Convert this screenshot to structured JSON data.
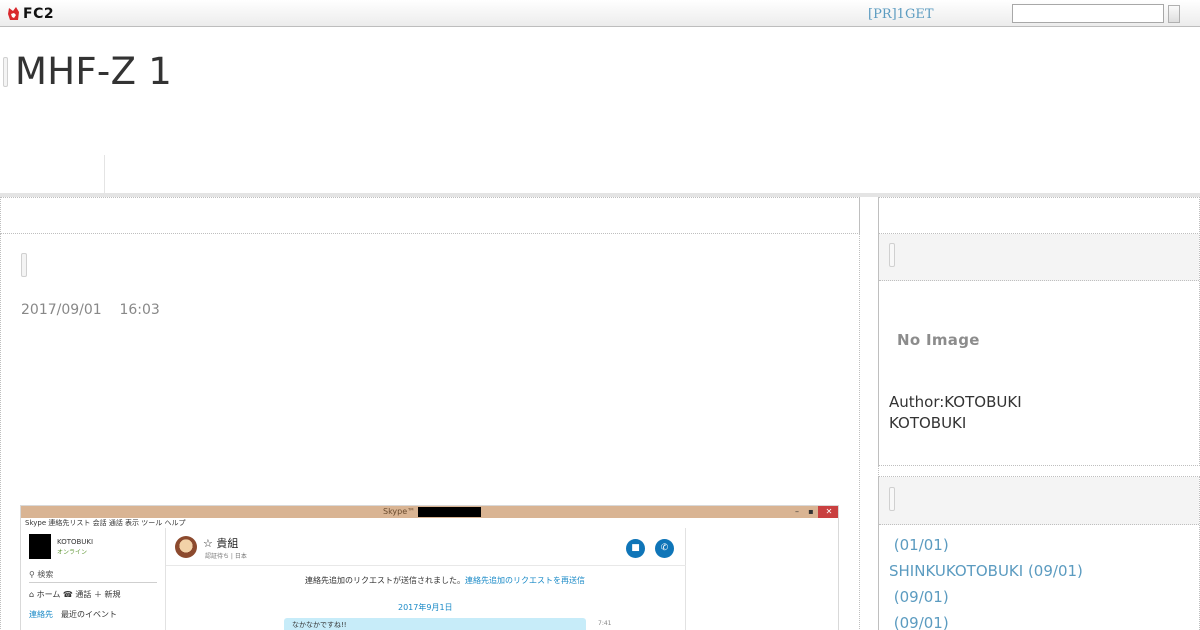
{
  "topbar": {
    "brand": "FC2",
    "pr_link": "[PR]1GET",
    "search_placeholder": ""
  },
  "header": {
    "site_title": "MHF-Z 1"
  },
  "entry": {
    "date": "2017/09/01    16:03",
    "screenshot": {
      "window_title": "Skype™",
      "menu": "Skype   連絡先リスト   会話   通話   表示   ツール   ヘルプ",
      "username": "KOTOBUKI",
      "status": "オンライン",
      "search_label": "検索",
      "nav": "ホーム   ☎ 通話   ＋ 新規",
      "tab_contacts": "連絡先",
      "tab_recent": "最近のイベント",
      "contact_name": "☆ 貴組",
      "contact_sub": "認証待ち | 日本",
      "request_text": "連絡先追加のリクエストが送信されました。",
      "request_link": "連絡先追加のリクエストを再送信",
      "day": "2017年9月1日",
      "bubble_text": "なかなかですね!!",
      "time": "7:41"
    }
  },
  "sidebar": {
    "profile": {
      "no_image": "No Image",
      "author_line": "Author:KOTOBUKI",
      "author_name": "KOTOBUKI"
    },
    "categories": [
      " (01/01)",
      "SHINKUKOTOBUKI (09/01)",
      " (09/01)",
      " (09/01)"
    ]
  },
  "colors": {
    "link": "#5b9bc0",
    "skype_blue": "#0f75b8",
    "titlebar": "#d9b493"
  }
}
